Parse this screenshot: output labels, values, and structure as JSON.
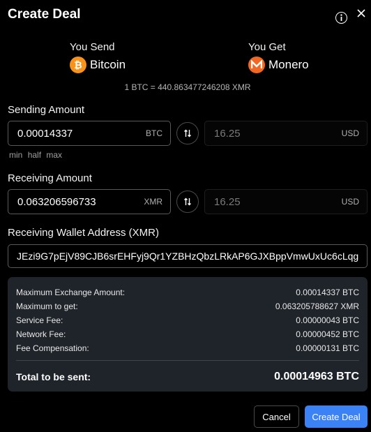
{
  "dialog": {
    "title": "Create Deal"
  },
  "coins": {
    "send_label": "You Send",
    "send_name": "Bitcoin",
    "get_label": "You Get",
    "get_name": "Monero",
    "rate_text": "1 BTC = 440.863477246208 XMR"
  },
  "sending": {
    "label": "Sending Amount",
    "amount": "0.00014337",
    "unit": "BTC",
    "usd_value": "16.25",
    "usd_unit": "USD",
    "min": "min",
    "half": "half",
    "max": "max"
  },
  "receiving": {
    "label": "Receiving Amount",
    "amount": "0.063206596733",
    "unit": "XMR",
    "usd_value": "16.25",
    "usd_unit": "USD"
  },
  "wallet": {
    "label": "Receiving Wallet Address (XMR)",
    "address": "JEzi9G7pEjV89CJB6srEHFyj9Qr1YZBHzQbzLRkAP6GJXBppVmwUxUc6cLqg"
  },
  "summary": {
    "rows": [
      {
        "label": "Maximum Exchange Amount:",
        "value": "0.00014337 BTC"
      },
      {
        "label": "Maximum to get:",
        "value": "0.063205788627 XMR"
      },
      {
        "label": "Service Fee:",
        "value": "0.00000043 BTC"
      },
      {
        "label": "Network Fee:",
        "value": "0.00000452 BTC"
      },
      {
        "label": "Fee Compensation:",
        "value": "0.00000131 BTC"
      }
    ],
    "total_label": "Total to be sent:",
    "total_value": "0.00014963 BTC"
  },
  "actions": {
    "cancel": "Cancel",
    "create": "Create Deal"
  },
  "colors": {
    "accent": "#3b82f6",
    "bitcoin": "#f7931a",
    "monero": "#f26822",
    "panel": "#1f242b"
  }
}
